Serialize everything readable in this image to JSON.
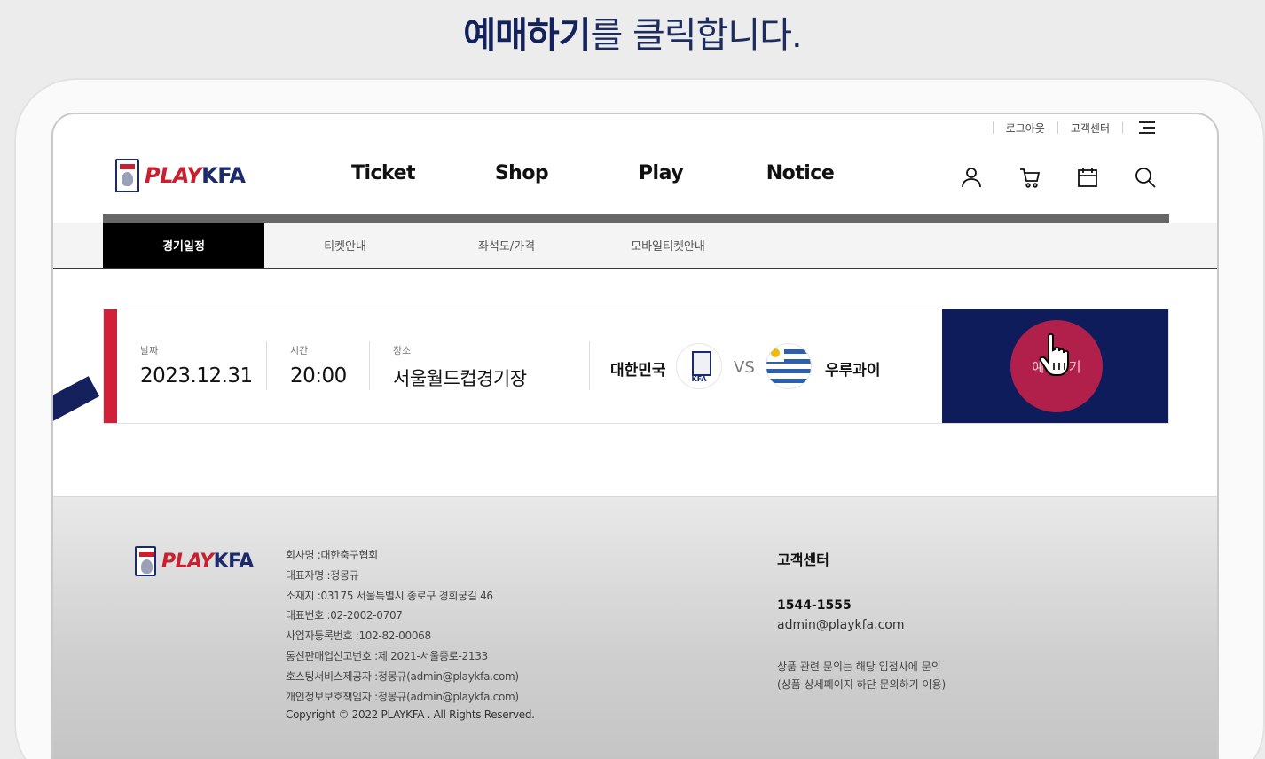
{
  "instruction": {
    "highlight": "예매하기",
    "rest": "를 클릭합니다."
  },
  "util": {
    "logout": "로그아웃",
    "customer_center": "고객센터"
  },
  "logo": {
    "part1": "PLAY",
    "part2": "KFA"
  },
  "nav": [
    {
      "label": "Ticket"
    },
    {
      "label": "Shop"
    },
    {
      "label": "Play"
    },
    {
      "label": "Notice"
    }
  ],
  "icons": {
    "user": "user-icon",
    "cart": "cart-icon",
    "calendar": "calendar-icon",
    "search": "search-icon",
    "menu": "menu-icon"
  },
  "tabs": [
    {
      "label": "경기일정",
      "active": true
    },
    {
      "label": "티켓안내",
      "active": false
    },
    {
      "label": "좌석도/가격",
      "active": false
    },
    {
      "label": "모바일티켓안내",
      "active": false
    }
  ],
  "match": {
    "date_label": "날짜",
    "date": "2023.12.31",
    "time_label": "시간",
    "time": "20:00",
    "venue_label": "장소",
    "venue": "서울월드컵경기장",
    "home_team": "대한민국",
    "vs": "VS",
    "away_team": "우루과이",
    "buy_button": "예매하기"
  },
  "colors": {
    "navy": "#0f1c5c",
    "red": "#d0203a",
    "buy": "#b0204a"
  },
  "footer": {
    "info": [
      "회사명 :대한축구협회",
      "대표자명 :정몽규",
      "소재지 :03175 서울특별시 종로구 경희궁길 46",
      "대표번호 :02-2002-0707",
      "사업자등록번호 :102-82-00068",
      "통신판매업신고번호 :제 2021-서울종로-2133",
      "호스팅서비스제공자 :정몽규(admin@playkfa.com)",
      "개인정보보호책임자 :정몽규(admin@playkfa.com)"
    ],
    "copyright": "Copyright © 2022 PLAYKFA . All Rights Reserved.",
    "cs_title": "고객센터",
    "cs_phone": "1544-1555",
    "cs_email": "admin@playkfa.com",
    "cs_note1": "상품 관련 문의는 해당 입점사에 문의",
    "cs_note2": "(상품 상세페이지 하단 문의하기 이용)"
  }
}
